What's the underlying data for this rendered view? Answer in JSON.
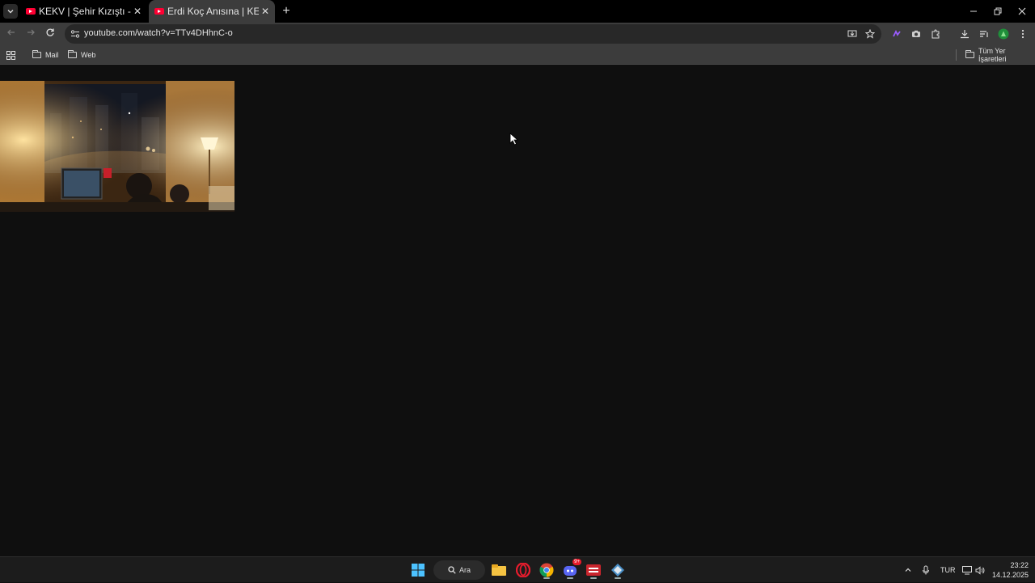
{
  "browser": {
    "tabs": [
      {
        "title": "KEKV | Şehir Kızıştı - YouTube",
        "active": false
      },
      {
        "title": "Erdi Koç Anısına | KEKV - YouTube",
        "active": true
      }
    ],
    "url": "youtube.com/watch?v=TTv4DHhnC-o",
    "bookmarks": [
      {
        "label": "Mail"
      },
      {
        "label": "Web"
      }
    ],
    "all_bookmarks_label": "Tüm Yer İşaretleri"
  },
  "taskbar": {
    "search_label": "Ara",
    "language": "TUR",
    "time": "23:22",
    "date": "14.12.2025",
    "discord_badge": "9+"
  },
  "colors": {
    "youtube_red": "#ff0033",
    "page_bg": "#0f0f0f",
    "toolbar_bg": "#3c3c3c"
  }
}
